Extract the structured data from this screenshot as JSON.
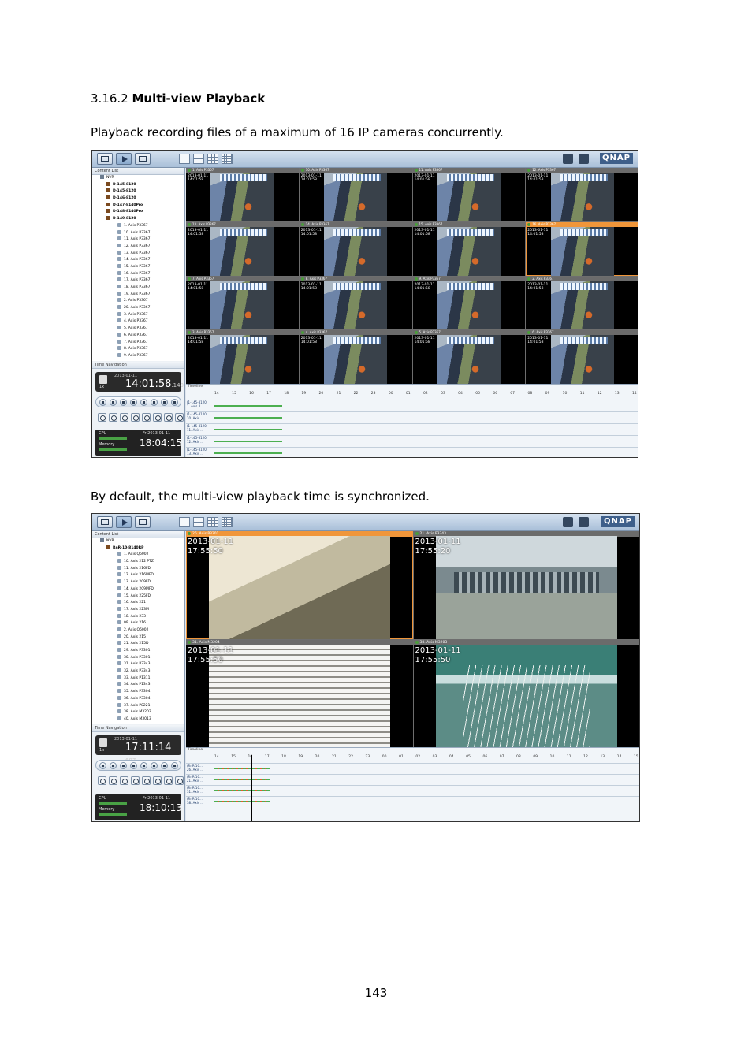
{
  "document": {
    "section_number": "3.16.2",
    "section_title": "Multi-view Playback",
    "intro": "Playback recording files of a maximum of 16 IP cameras concurrently.",
    "sync_note": "By default, the multi-view playback time is synchronized.",
    "page_number": "143"
  },
  "screenshot1": {
    "logo": "QNAP",
    "content_list_label": "Content List",
    "tree_root": "NVR",
    "servers": [
      "D-145-8120",
      "D-145-8120",
      "D-146-8120",
      "D-147-8140Pro",
      "D-148-8140Pro",
      "D-149-8120"
    ],
    "cameras": [
      "1. Axis P3367",
      "10. Axis P3367",
      "11. Axis P3367",
      "12. Axis P3367",
      "13. Axis P3367",
      "14. Axis P3367",
      "15. Axis P3367",
      "16. Axis P3367",
      "17. Axis P3367",
      "18. Axis P3367",
      "19. Axis P3367",
      "2. Axis P3367",
      "20. Axis P3367",
      "3. Axis P3367",
      "4. Axis P3367",
      "5. Axis P3367",
      "6. Axis P3367",
      "7. Axis P3367",
      "8. Axis P3367",
      "9. Axis P3367"
    ],
    "time_navigation_label": "Time Navigation",
    "date": "2013-01-11",
    "time": "14:01:58",
    "milliseconds": ".140",
    "speed": "1x",
    "cpu_label": "CPU",
    "memory_label": "Memory",
    "sys_date": "Fr 2013-01-11",
    "sys_time": "18:04:15",
    "tooltip": "Play",
    "grid": [
      {
        "title": "1. Axis P3367",
        "date": "2013-01-11",
        "time": "14:01:58"
      },
      {
        "title": "10. Axis P3367",
        "date": "2013-01-11",
        "time": "14:01:58"
      },
      {
        "title": "11. Axis P3367",
        "date": "2013-01-11",
        "time": "14:01:58"
      },
      {
        "title": "12. Axis P3367",
        "date": "2013-01-11",
        "time": "14:01:58"
      },
      {
        "title": "13. Axis P3367",
        "date": "2013-01-11",
        "time": "14:01:58"
      },
      {
        "title": "14. Axis P3367",
        "date": "2013-01-11",
        "time": "14:01:58"
      },
      {
        "title": "15. Axis P3367",
        "date": "2013-01-11",
        "time": "14:01:58"
      },
      {
        "title": "16. Axis P3367",
        "date": "2013-01-11",
        "time": "14:01:58"
      },
      {
        "title": "7. Axis P3367",
        "date": "2013-01-11",
        "time": "14:01:58"
      },
      {
        "title": "8. Axis P3367",
        "date": "2013-01-11",
        "time": "14:01:58"
      },
      {
        "title": "9. Axis P3367",
        "date": "2013-01-11",
        "time": "14:01:58"
      },
      {
        "title": "2. Axis P3367",
        "date": "2013-01-11",
        "time": "14:01:58"
      },
      {
        "title": "3. Axis P3367",
        "date": "2013-01-11",
        "time": "14:01:58"
      },
      {
        "title": "4. Axis P3367",
        "date": "2013-01-11",
        "time": "14:01:58"
      },
      {
        "title": "5. Axis P3367",
        "date": "2013-01-11",
        "time": "14:01:58"
      },
      {
        "title": "6. Axis P3367",
        "date": "2013-01-11",
        "time": "14:01:58"
      }
    ],
    "selected_cell": 7,
    "timeline_label": "Timeline",
    "timeline_hours": [
      "14",
      "15",
      "16",
      "17",
      "18",
      "19",
      "20",
      "21",
      "22",
      "23",
      "00",
      "01",
      "02",
      "03",
      "04",
      "05",
      "06",
      "07",
      "08",
      "09",
      "10",
      "11",
      "12",
      "13",
      "14"
    ],
    "timeline_rows": [
      "(1-145-8120)\n1. Axis P...",
      "(1-145-8120)\n10. Axis ...",
      "(1-145-8120)\n11. Axis ...",
      "(1-145-8120)\n12. Axis ...",
      "(1-145-8120)\n13. Axis ..."
    ]
  },
  "screenshot2": {
    "logo": "QNAP",
    "content_list_label": "Content List",
    "tree_root": "NVR",
    "server": "RnR-10-8140RP",
    "cameras": [
      "1. Axis Q6002",
      "10. Axis 212 PTZ",
      "11. Axis 216FD",
      "12. Axis 216MFD",
      "13. Axis 209FD",
      "14. Axis 209MFD",
      "15. Axis 225FD",
      "16. Axis 221",
      "17. Axis 223M",
      "18. Axis 233",
      "09. Axis 216",
      "2. Axis Q6002",
      "20. Axis 215",
      "21. Axis 215D",
      "29. Axis P3301",
      "30. Axis P3301",
      "31. Axis P3343",
      "32. Axis P3343",
      "33. Axis P1311",
      "34. Axis P1343",
      "35. Axis P3304",
      "36. Axis P3304",
      "37. Axis P8221",
      "38. Axis M3203",
      "40. Axis M3013"
    ],
    "time_navigation_label": "Time Navigation",
    "date": "2013-01-11",
    "time": "17:11:14",
    "milliseconds": "697",
    "speed": "1x",
    "cpu_label": "CPU",
    "memory_label": "Memory",
    "sys_date": "Fr 2013-01-11",
    "sys_time": "18:10:13",
    "grid": [
      {
        "title": "26. Axis P3301",
        "date": "2013-01-11",
        "time": "17:55:50",
        "scene": "wall"
      },
      {
        "title": "21. Axis P3343",
        "date": "2013-01-11",
        "time": "17:55:20",
        "scene": "room"
      },
      {
        "title": "31. Axis M3204",
        "date": "2013-01-11",
        "time": "17:55:50",
        "scene": "blinds"
      },
      {
        "title": "38. Axis M3203",
        "date": "2013-01-11",
        "time": "17:55:50",
        "scene": "wires"
      }
    ],
    "selected_cell": 0,
    "timeline_label": "Timeline",
    "timeline_hours": [
      "14",
      "15",
      "16",
      "17",
      "18",
      "19",
      "20",
      "21",
      "22",
      "23",
      "00",
      "01",
      "02",
      "03",
      "04",
      "05",
      "06",
      "07",
      "08",
      "09",
      "10",
      "11",
      "12",
      "13",
      "14",
      "15"
    ],
    "timeline_rows": [
      "(RnR-10...\n26. Axis ...",
      "(RnR-10...\n21. Axis ...",
      "(RnR-10...\n31. Axis ...",
      "(RnR-10...\n38. Axis ..."
    ]
  }
}
